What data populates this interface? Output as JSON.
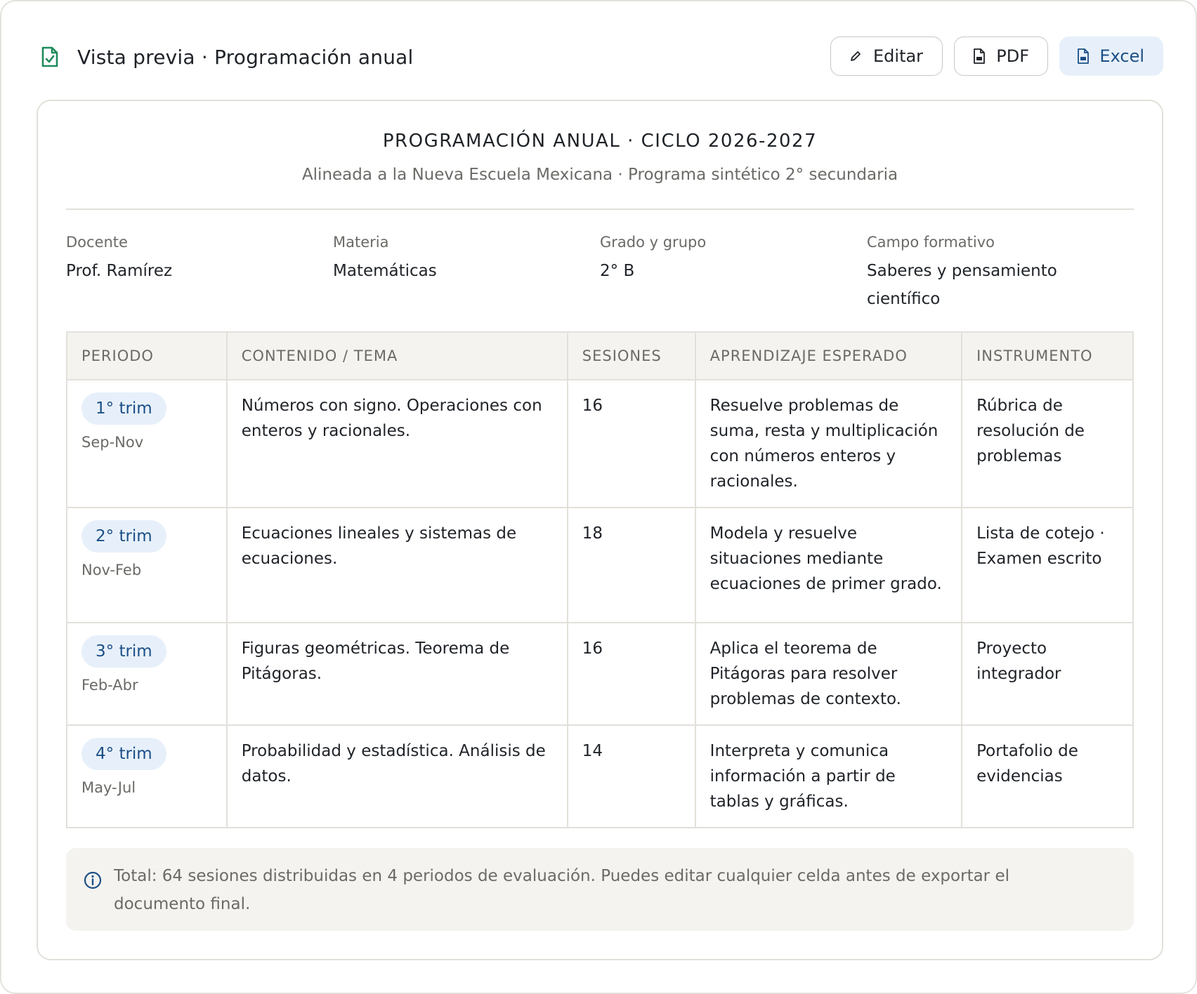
{
  "header": {
    "title": "Vista previa · Programación anual",
    "title_icon": "file-check-icon",
    "actions": [
      {
        "label": "Editar",
        "icon": "pencil-icon"
      },
      {
        "label": "PDF",
        "icon": "file-pdf-icon"
      },
      {
        "label": "Excel",
        "icon": "file-xls-icon"
      }
    ]
  },
  "document": {
    "title": "PROGRAMACIÓN ANUAL · CICLO 2026-2027",
    "subtitle": "Alineada a la Nueva Escuela Mexicana · Programa sintético 2° secundaria",
    "meta": [
      {
        "label": "Docente",
        "value": "Prof. Ramírez"
      },
      {
        "label": "Materia",
        "value": "Matemáticas"
      },
      {
        "label": "Grado y grupo",
        "value": "2° B"
      },
      {
        "label": "Campo formativo",
        "value": "Saberes y pensamiento científico"
      }
    ],
    "table": {
      "headers": [
        "PERIODO",
        "CONTENIDO / TEMA",
        "SESIONES",
        "APRENDIZAJE ESPERADO",
        "INSTRUMENTO"
      ],
      "rows": [
        {
          "period": "1° trim",
          "range": "Sep-Nov",
          "content": "Números con signo. Operaciones con enteros y racionales.",
          "sessions": "16",
          "learning": "Resuelve problemas de suma, resta y multiplicación con números enteros y racionales.",
          "instrument": "Rúbrica de resolución de problemas"
        },
        {
          "period": "2° trim",
          "range": "Nov-Feb",
          "content": "Ecuaciones lineales y sistemas de ecuaciones.",
          "sessions": "18",
          "learning": "Modela y resuelve situaciones mediante ecuaciones de primer grado.",
          "instrument": "Lista de cotejo · Examen escrito"
        },
        {
          "period": "3° trim",
          "range": "Feb-Abr",
          "content": "Figuras geométricas. Teorema de Pitágoras.",
          "sessions": "16",
          "learning": "Aplica el teorema de Pitágoras para resolver problemas de contexto.",
          "instrument": "Proyecto integrador"
        },
        {
          "period": "4° trim",
          "range": "May-Jul",
          "content": "Probabilidad y estadística. Análisis de datos.",
          "sessions": "14",
          "learning": "Interpreta y comunica información a partir de tablas y gráficas.",
          "instrument": "Portafolio de evidencias"
        }
      ]
    },
    "note": {
      "icon": "info-icon",
      "text": "Total: 64 sesiones distribuidas en 4 periodos de evaluación. Puedes editar cualquier celda antes de exportar el documento final."
    }
  },
  "colors": {
    "accent": "#1b4f86",
    "accent_bg": "#e7f0fa",
    "success_icon": "#1f8a5b",
    "muted_text": "#6b6a66",
    "border": "#e2e0da",
    "panel_bg": "#f4f3ef"
  }
}
